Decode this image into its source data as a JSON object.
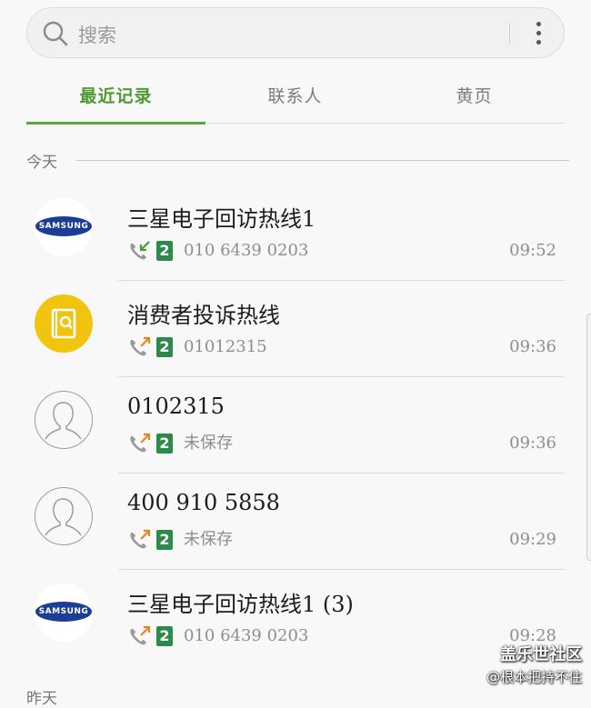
{
  "search": {
    "placeholder": "搜索"
  },
  "tabs": [
    {
      "label": "最近记录",
      "active": true
    },
    {
      "label": "联系人",
      "active": false
    },
    {
      "label": "黄页",
      "active": false
    }
  ],
  "sections": {
    "today": "今天",
    "yesterday": "昨天"
  },
  "calls": [
    {
      "name": "三星电子回访热线1",
      "avatar": "samsung-logo",
      "avatar_text": "SAMSUNG",
      "call_type": "incoming-call-icon",
      "sim": "2",
      "detail": "010 6439 0203",
      "time": "09:52"
    },
    {
      "name": "消费者投诉热线",
      "avatar": "yellow-pages-icon",
      "call_type": "outgoing-call-icon",
      "sim": "2",
      "detail": "01012315",
      "time": "09:36"
    },
    {
      "name": "0102315",
      "avatar": "default-avatar-icon",
      "call_type": "outgoing-call-icon",
      "sim": "2",
      "detail": "未保存",
      "time": "09:36"
    },
    {
      "name": "400 910 5858",
      "avatar": "default-avatar-icon",
      "call_type": "outgoing-call-icon",
      "sim": "2",
      "detail": "未保存",
      "time": "09:29"
    },
    {
      "name": "三星电子回访热线1 (3)",
      "avatar": "samsung-logo",
      "avatar_text": "SAMSUNG",
      "call_type": "outgoing-call-icon",
      "sim": "2",
      "detail": "010 6439 0203",
      "time": "09:28"
    }
  ],
  "watermark": {
    "title": "盖乐世社区",
    "subtitle": "@根本把持不住"
  },
  "colors": {
    "accent": "#5aa83b",
    "sim_badge": "#2c8a4b",
    "incoming_arrow": "#4f9a35",
    "outgoing_arrow": "#e08a1e",
    "samsung_blue": "#1c3d96",
    "yellow_pages": "#f1c40f"
  }
}
